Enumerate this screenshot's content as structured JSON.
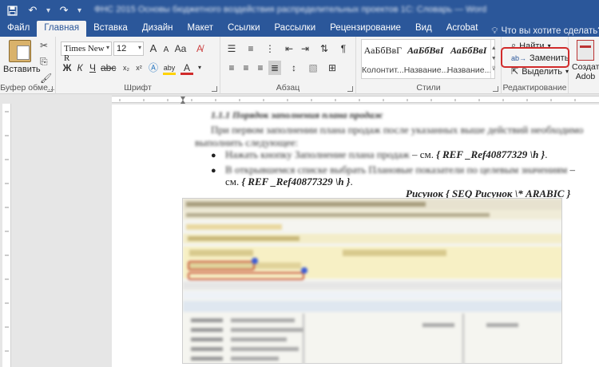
{
  "window": {
    "title": "ФНС 2015 Основы бюджетного воздействия распределительных проектов 1С: Словарь — Word"
  },
  "quick_access": {
    "save_icon": "save-icon",
    "undo_icon": "undo-icon",
    "redo_icon": "redo-icon",
    "customize_icon": "customize-qat-icon"
  },
  "tabs": [
    {
      "label": "Файл"
    },
    {
      "label": "Главная"
    },
    {
      "label": "Вставка"
    },
    {
      "label": "Дизайн"
    },
    {
      "label": "Макет"
    },
    {
      "label": "Ссылки"
    },
    {
      "label": "Рассылки"
    },
    {
      "label": "Рецензирование"
    },
    {
      "label": "Вид"
    },
    {
      "label": "Acrobat"
    }
  ],
  "tell_me": {
    "label": "Что вы хотите сделать?"
  },
  "clipboard": {
    "paste_label": "Вставить",
    "group_label": "Буфер обме..."
  },
  "font": {
    "family": "Times New R",
    "size": "12",
    "group_label": "Шрифт",
    "bold": "Ж",
    "italic": "К",
    "underline": "Ч",
    "grow": "A",
    "shrink": "A",
    "font_color": "A",
    "highlight": "aby"
  },
  "paragraph": {
    "group_label": "Абзац",
    "pilcrow": "¶"
  },
  "styles": {
    "group_label": "Стили",
    "items": [
      {
        "preview": "АаБбВвГ",
        "name": "Колонтит..."
      },
      {
        "preview": "АаБбВвІ",
        "name": "Название..."
      },
      {
        "preview": "АаБбВвІ",
        "name": "Название..."
      }
    ]
  },
  "editing": {
    "find_label": "Найти",
    "replace_label": "Заменить",
    "select_label": "Выделить",
    "group_label": "Редактирование"
  },
  "extra": {
    "create_label": "Создать",
    "adobe_label": "Adob"
  },
  "document": {
    "heading": "1.1.1   Порядок заполнения плана продаж",
    "para1_line1": "При первом заполнении плана продаж после указанных выше действий необходимо",
    "para1_line2": "выполнить следующее:",
    "bullet1_blur": "Нажать кнопку Заполнение плана продаж",
    "bullet1_tail": " – см. ",
    "bullet1_field": "{ REF _Ref40877329 \\h }",
    "bullet1_end": ".",
    "bullet2_blur": "В открывшемся списке выбрать Плановые показатели по целевым значениям",
    "bullet2_tail": " –",
    "bullet2_line2_pre": "см. ",
    "bullet2_field": "{ REF _Ref40877329 \\h }",
    "bullet2_end": ".",
    "caption": "Рисунок { SEQ Рисунок \\* ARABIC }"
  }
}
